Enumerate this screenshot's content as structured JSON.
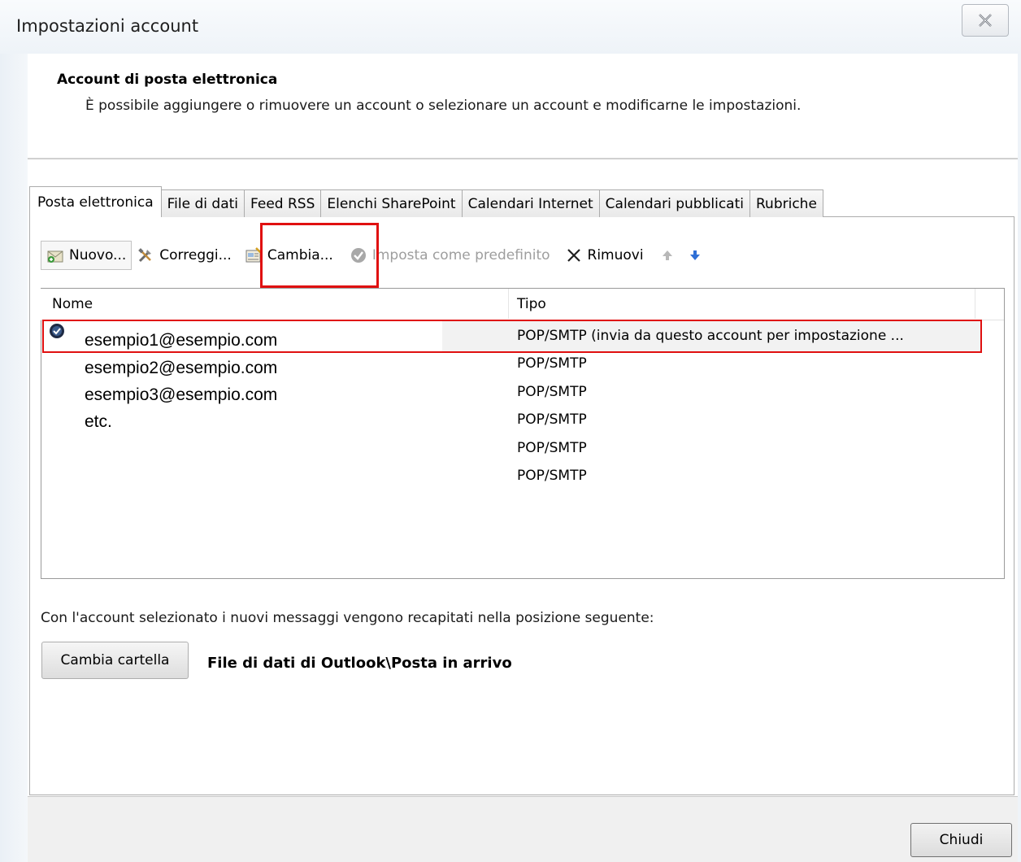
{
  "window": {
    "title": "Impostazioni account"
  },
  "header": {
    "title": "Account di posta elettronica",
    "description": "È possibile aggiungere o rimuovere un account o selezionare un account e modificarne le impostazioni."
  },
  "tabs": [
    {
      "label": "Posta elettronica",
      "active": true
    },
    {
      "label": "File di dati"
    },
    {
      "label": "Feed RSS"
    },
    {
      "label": "Elenchi SharePoint"
    },
    {
      "label": "Calendari Internet"
    },
    {
      "label": "Calendari pubblicati"
    },
    {
      "label": "Rubriche"
    }
  ],
  "toolbar": {
    "new_label": "Nuovo...",
    "repair_label": "Correggi...",
    "change_label": "Cambia...",
    "set_default_label": "Imposta come predefinito",
    "remove_label": "Rimuovi"
  },
  "list": {
    "columns": {
      "name": "Nome",
      "type": "Tipo"
    },
    "names": [
      "esempio1@esempio.com",
      "esempio2@esempio.com",
      "esempio3@esempio.com",
      "etc."
    ],
    "types": [
      "POP/SMTP (invia da questo account per impostazione ...",
      "POP/SMTP",
      "POP/SMTP",
      "POP/SMTP",
      "POP/SMTP",
      "POP/SMTP"
    ]
  },
  "delivery": {
    "text": "Con l'account selezionato i nuovi messaggi vengono recapitati nella posizione seguente:",
    "change_folder_label": "Cambia cartella",
    "data_file_path": "File di dati di Outlook\\Posta in arrivo"
  },
  "footer": {
    "close_label": "Chiudi"
  },
  "colors": {
    "highlight": "#e01010",
    "accent_arrow": "#2f6fd6"
  }
}
